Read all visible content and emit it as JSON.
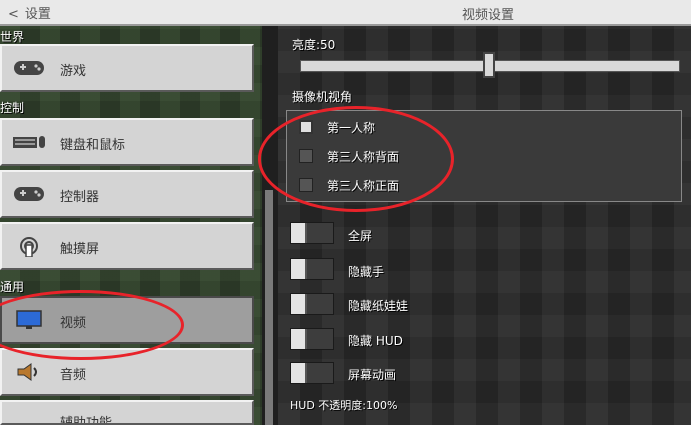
{
  "header": {
    "back_label": "设置",
    "title": "视频设置"
  },
  "sidebar": {
    "sections": {
      "world": "世界",
      "controls": "控制",
      "general": "通用"
    },
    "items": [
      {
        "label": "游戏",
        "icon": "gamepad-icon"
      },
      {
        "label": "键盘和鼠标",
        "icon": "keyboard-mouse-icon"
      },
      {
        "label": "控制器",
        "icon": "controller-icon"
      },
      {
        "label": "触摸屏",
        "icon": "touch-icon"
      },
      {
        "label": "视频",
        "icon": "monitor-icon",
        "selected": true
      },
      {
        "label": "音频",
        "icon": "speaker-icon"
      },
      {
        "label": "辅助功能",
        "icon": "accessibility-icon"
      }
    ]
  },
  "settings": {
    "brightness_label": "亮度:50",
    "brightness_value": 0.5,
    "camera_label": "摄像机视角",
    "camera_options": [
      {
        "label": "第一人称",
        "checked": true
      },
      {
        "label": "第三人称背面",
        "checked": false
      },
      {
        "label": "第三人称正面",
        "checked": false
      }
    ],
    "toggles": [
      {
        "label": "全屏",
        "on": false
      },
      {
        "label": "隐藏手",
        "on": false
      },
      {
        "label": "隐藏纸娃娃",
        "on": false
      },
      {
        "label": "隐藏 HUD",
        "on": false
      },
      {
        "label": "屏幕动画",
        "on": false
      }
    ],
    "hud_opacity_label": "HUD 不透明度:100%"
  },
  "colors": {
    "highlight": "#e8232a"
  }
}
